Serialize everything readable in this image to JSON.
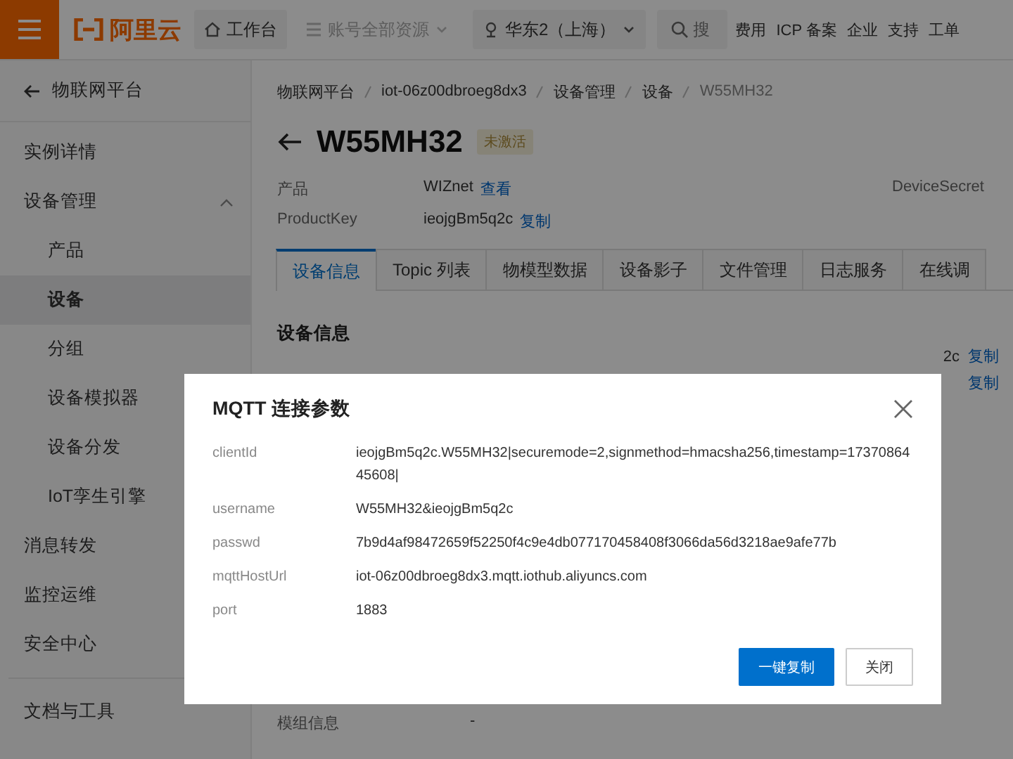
{
  "topbar": {
    "logo_text": "阿里云",
    "nav": [
      {
        "kind": "home",
        "label": "工作台"
      },
      {
        "kind": "resource",
        "label": "账号全部资源"
      },
      {
        "kind": "region",
        "label": "华东2（上海）"
      }
    ],
    "search": {
      "placeholder": "搜"
    },
    "links": [
      "费用",
      "ICP 备案",
      "企业",
      "支持",
      "工单"
    ]
  },
  "sidebar": {
    "back": "物联网平台",
    "items": [
      {
        "label": "实例详情",
        "selected": false
      },
      {
        "label": "设备管理",
        "selected": false,
        "expanded": true,
        "children": [
          {
            "label": "产品",
            "selected": false
          },
          {
            "label": "设备",
            "selected": true
          },
          {
            "label": "分组",
            "selected": false
          },
          {
            "label": "设备模拟器",
            "selected": false
          },
          {
            "label": "设备分发",
            "selected": false
          },
          {
            "label": "IoT孪生引擎",
            "selected": false
          }
        ]
      },
      {
        "label": "消息转发",
        "selected": false
      },
      {
        "label": "监控运维",
        "selected": false
      },
      {
        "label": "安全中心",
        "selected": false
      }
    ],
    "bottom_items": [
      {
        "label": "文档与工具",
        "selected": false
      }
    ]
  },
  "breadcrumb": [
    "物联网平台",
    "iot-06z00dbroeg8dx3",
    "设备管理",
    "设备",
    "W55MH32"
  ],
  "device": {
    "name": "W55MH32",
    "status": "未激活",
    "fields": [
      {
        "label": "产品",
        "value": "WIZnet",
        "action": "查看"
      },
      {
        "label": "ProductKey",
        "value": "ieojgBm5q2c",
        "action": "复制"
      }
    ],
    "secret_label": "DeviceSecret"
  },
  "tabs": [
    {
      "label": "设备信息",
      "selected": true
    },
    {
      "label": "Topic 列表",
      "selected": false
    },
    {
      "label": "物模型数据",
      "selected": false
    },
    {
      "label": "设备影子",
      "selected": false
    },
    {
      "label": "文件管理",
      "selected": false
    },
    {
      "label": "日志服务",
      "selected": false
    },
    {
      "label": "在线调",
      "selected": false
    }
  ],
  "section_title": "设备信息",
  "partial_rows": [
    {
      "value": "2c",
      "action": "复制"
    },
    {
      "value": "",
      "action": "复制"
    }
  ],
  "bottom_row": {
    "label": "模组信息",
    "value": "-"
  },
  "dialog": {
    "title": "MQTT 连接参数",
    "params": [
      {
        "label": "clientId",
        "value": "ieojgBm5q2c.W55MH32|securemode=2,signmethod=hmacsha256,timestamp=1737086445608|"
      },
      {
        "label": "username",
        "value": "W55MH32&ieojgBm5q2c"
      },
      {
        "label": "passwd",
        "value": "7b9d4af98472659f52250f4c9e4db077170458408f3066da56d3218ae9afe77b"
      },
      {
        "label": "mqttHostUrl",
        "value": "iot-06z00dbroeg8dx3.mqtt.iothub.aliyuncs.com"
      },
      {
        "label": "port",
        "value": "1883"
      }
    ],
    "buttons": [
      {
        "kind": "primary",
        "label": "一键复制"
      },
      {
        "kind": "default",
        "label": "关闭"
      }
    ]
  }
}
